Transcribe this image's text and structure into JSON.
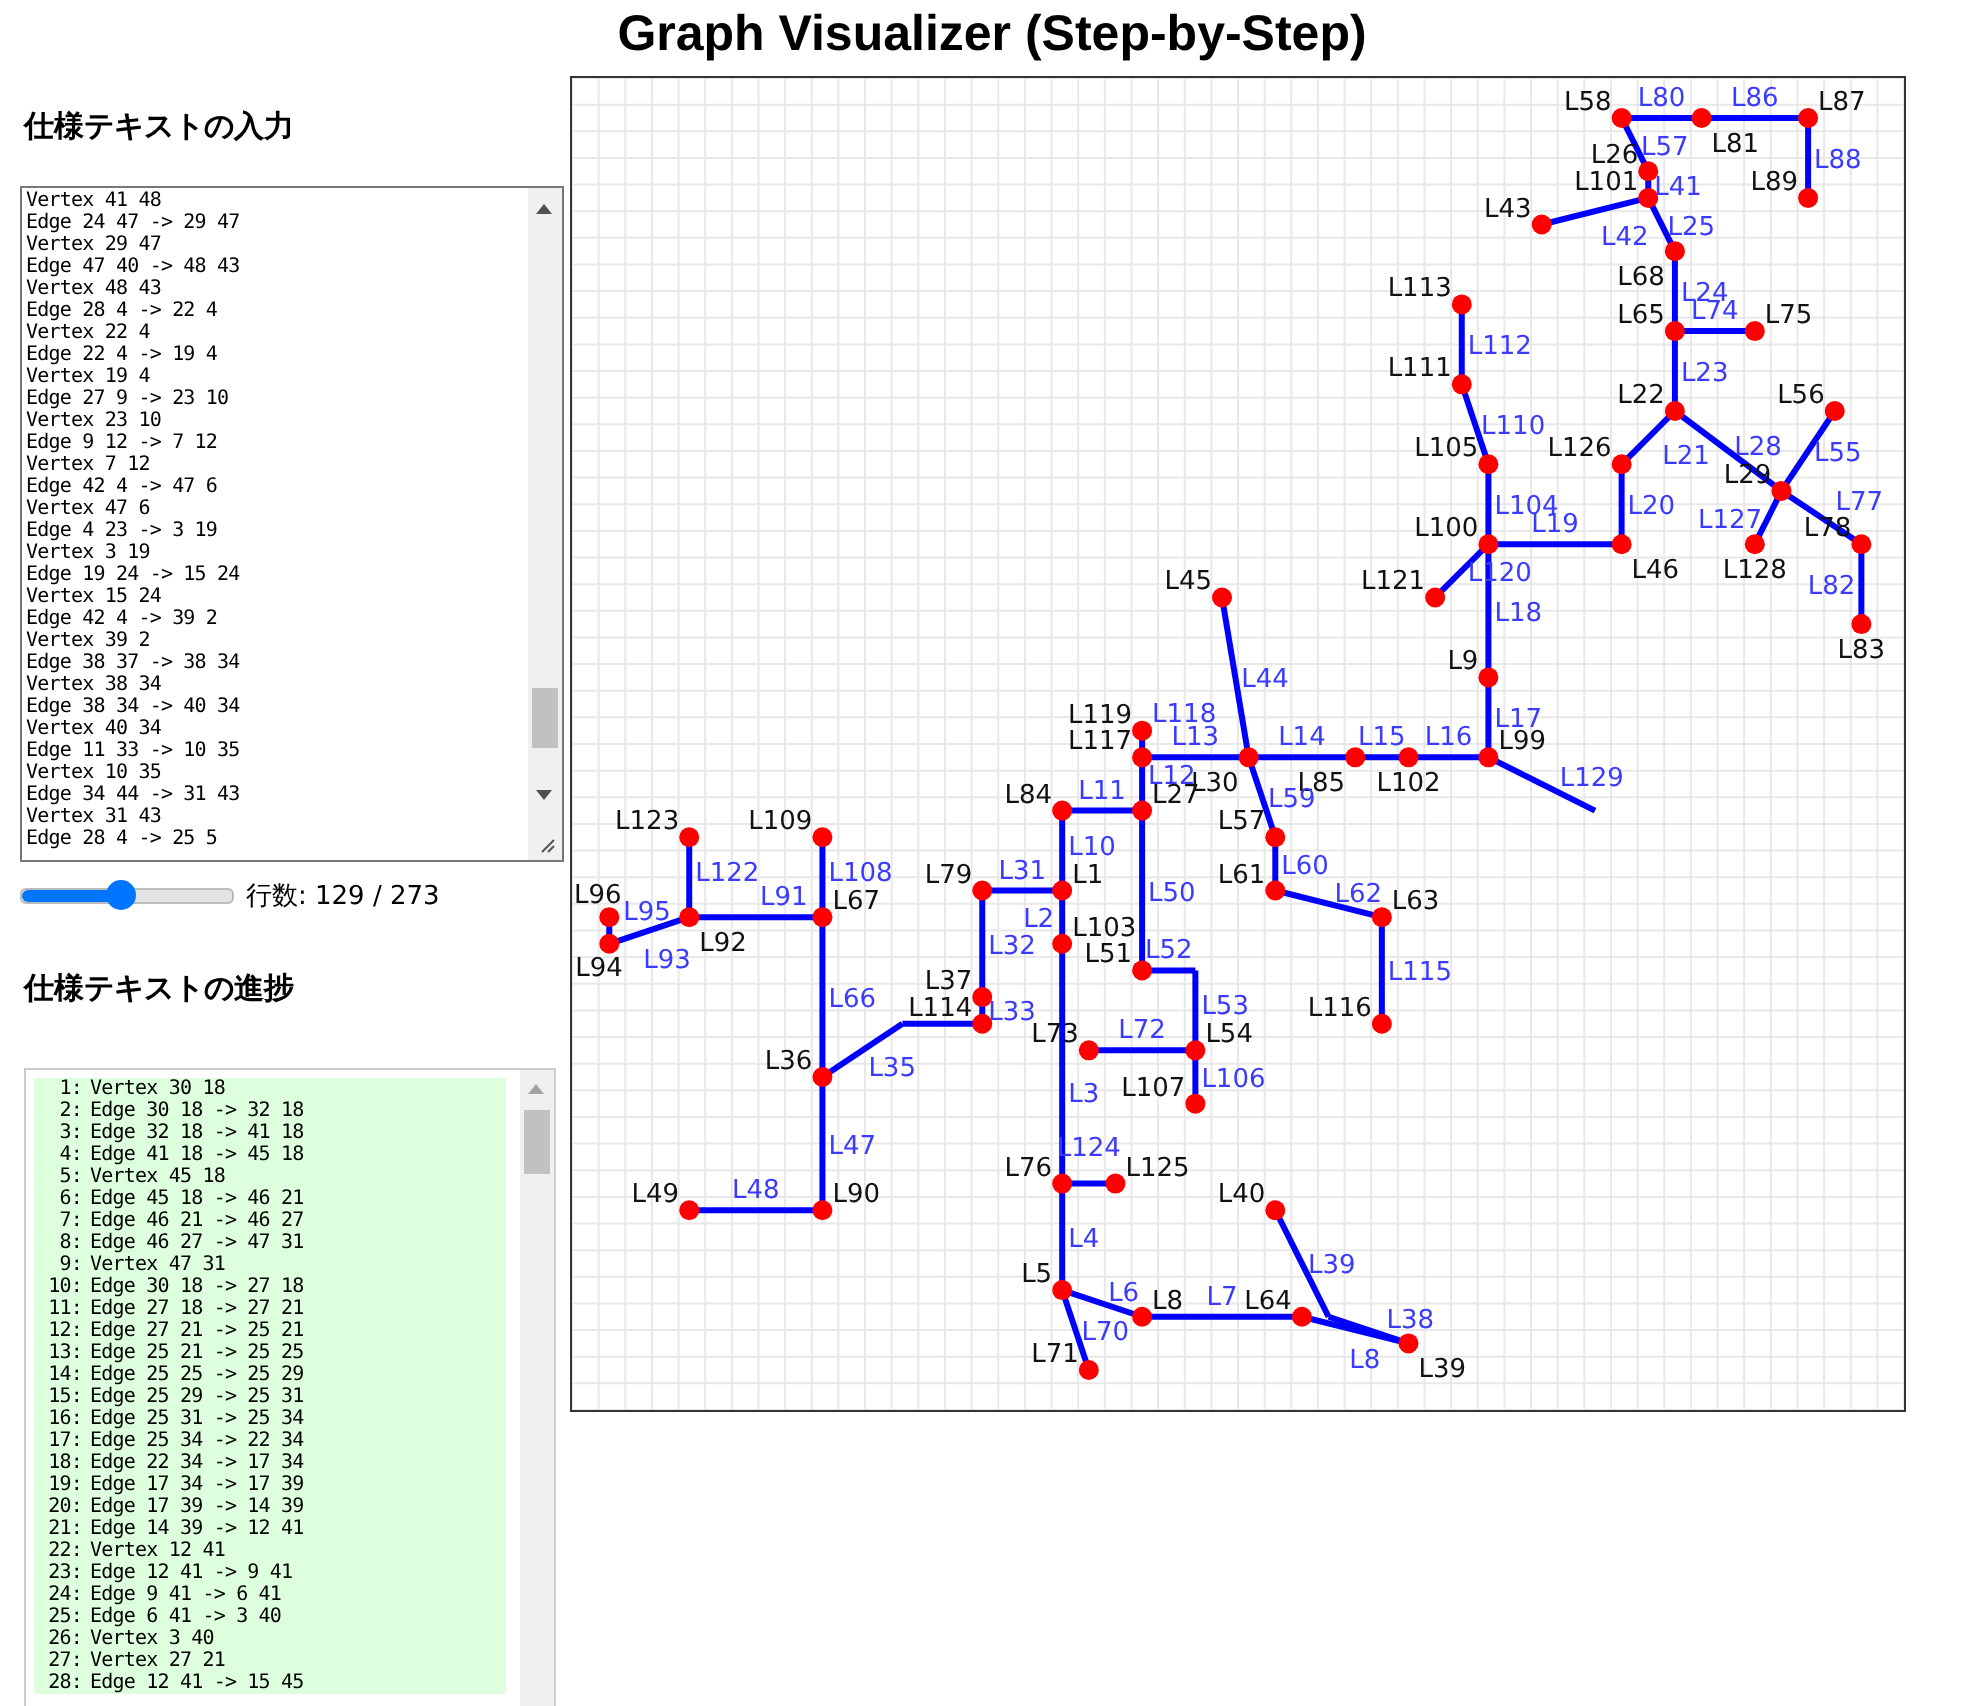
{
  "title": "Graph Visualizer (Step-by-Step)",
  "input_panel": {
    "heading": "仕様テキストの入力",
    "lines": [
      "Vertex 41 48",
      "Edge 24 47 -> 29 47",
      "Vertex 29 47",
      "Edge 47 40 -> 48 43",
      "Vertex 48 43",
      "Edge 28 4 -> 22 4",
      "Vertex 22 4",
      "Edge 22 4 -> 19 4",
      "Vertex 19 4",
      "Edge 27 9 -> 23 10",
      "Vertex 23 10",
      "Edge 9 12 -> 7 12",
      "Vertex 7 12",
      "Edge 42 4 -> 47 6",
      "Vertex 47 6",
      "Edge 4 23 -> 3 19",
      "Vertex 3 19",
      "Edge 19 24 -> 15 24",
      "Vertex 15 24",
      "Edge 42 4 -> 39 2",
      "Vertex 39 2",
      "Edge 38 37 -> 38 34",
      "Vertex 38 34",
      "Edge 38 34 -> 40 34",
      "Vertex 40 34",
      "Edge 11 33 -> 10 35",
      "Vertex 10 35",
      "Edge 34 44 -> 31 43",
      "Vertex 31 43",
      "Edge 28 4 -> 25 5"
    ],
    "slider": {
      "level": 0.47
    },
    "line_count": "行数: 129 / 273"
  },
  "progress_panel": {
    "heading": "仕様テキストの進捗",
    "lines": [
      {
        "num": "1:",
        "text": "Vertex 30 18",
        "done": true
      },
      {
        "num": "2:",
        "text": "Edge 30 18 -> 32 18",
        "done": true
      },
      {
        "num": "3:",
        "text": "Edge 32 18 -> 41 18",
        "done": true
      },
      {
        "num": "4:",
        "text": "Edge 41 18 -> 45 18",
        "done": true
      },
      {
        "num": "5:",
        "text": "Vertex 45 18",
        "done": true
      },
      {
        "num": "6:",
        "text": "Edge 45 18 -> 46 21",
        "done": true
      },
      {
        "num": "7:",
        "text": "Edge 46 21 -> 46 27",
        "done": true
      },
      {
        "num": "8:",
        "text": "Edge 46 27 -> 47 31",
        "done": true
      },
      {
        "num": "9:",
        "text": "Vertex 47 31",
        "done": true
      },
      {
        "num": "10:",
        "text": "Edge 30 18 -> 27 18",
        "done": true
      },
      {
        "num": "11:",
        "text": "Edge 27 18 -> 27 21",
        "done": true
      },
      {
        "num": "12:",
        "text": "Edge 27 21 -> 25 21",
        "done": true
      },
      {
        "num": "13:",
        "text": "Edge 25 21 -> 25 25",
        "done": true
      },
      {
        "num": "14:",
        "text": "Edge 25 25 -> 25 29",
        "done": true
      },
      {
        "num": "15:",
        "text": "Edge 25 29 -> 25 31",
        "done": true
      },
      {
        "num": "16:",
        "text": "Edge 25 31 -> 25 34",
        "done": true
      },
      {
        "num": "17:",
        "text": "Edge 25 34 -> 22 34",
        "done": true
      },
      {
        "num": "18:",
        "text": "Edge 22 34 -> 17 34",
        "done": true
      },
      {
        "num": "19:",
        "text": "Edge 17 34 -> 17 39",
        "done": true
      },
      {
        "num": "20:",
        "text": "Edge 17 39 -> 14 39",
        "done": true
      },
      {
        "num": "21:",
        "text": "Edge 14 39 -> 12 41",
        "done": true
      },
      {
        "num": "22:",
        "text": "Vertex 12 41",
        "done": true
      },
      {
        "num": "23:",
        "text": "Edge 12 41 -> 9 41",
        "done": true
      },
      {
        "num": "24:",
        "text": "Edge 9 41 -> 6 41",
        "done": true
      },
      {
        "num": "25:",
        "text": "Edge 6 41 -> 3 40",
        "done": true
      },
      {
        "num": "26:",
        "text": "Vertex 3 40",
        "done": true
      },
      {
        "num": "27:",
        "text": "Vertex 27 21",
        "done": true
      },
      {
        "num": "28:",
        "text": "Edge 12 41 -> 15 45",
        "done": true
      }
    ]
  },
  "graph": {
    "nodes": [
      {
        "label": "L58"
      },
      {
        "label": "L81"
      },
      {
        "label": "L87"
      },
      {
        "label": "L26"
      },
      {
        "label": "L101"
      },
      {
        "label": "L89"
      },
      {
        "label": "L43"
      },
      {
        "label": "L68"
      },
      {
        "label": "L113"
      },
      {
        "label": "L65"
      },
      {
        "label": "L75"
      },
      {
        "label": "L111"
      },
      {
        "label": "L22"
      },
      {
        "label": "L56"
      },
      {
        "label": "L105"
      },
      {
        "label": "L126"
      },
      {
        "label": "L29"
      },
      {
        "label": "L100"
      },
      {
        "label": "L46"
      },
      {
        "label": "L128"
      },
      {
        "label": "L78"
      },
      {
        "label": "L45"
      },
      {
        "label": "L121"
      },
      {
        "label": "L83"
      },
      {
        "label": "L9"
      },
      {
        "label": "L119"
      },
      {
        "label": "L117"
      },
      {
        "label": "L30"
      },
      {
        "label": "L85"
      },
      {
        "label": "L102"
      },
      {
        "label": "L99"
      },
      {
        "label": "L84"
      },
      {
        "label": "L27"
      },
      {
        "label": "L123"
      },
      {
        "label": "L109"
      },
      {
        "label": "L57"
      },
      {
        "label": "L79"
      },
      {
        "label": "L1"
      },
      {
        "label": "L61"
      },
      {
        "label": "L96"
      },
      {
        "label": "L92"
      },
      {
        "label": "L67"
      },
      {
        "label": "L63"
      },
      {
        "label": "L94"
      },
      {
        "label": "L103"
      },
      {
        "label": "L51"
      },
      {
        "label": "L37"
      },
      {
        "label": "L114"
      },
      {
        "label": "L116"
      },
      {
        "label": "L73"
      },
      {
        "label": "L54"
      },
      {
        "label": "L36"
      },
      {
        "label": "L107"
      },
      {
        "label": "L76"
      },
      {
        "label": "L125"
      },
      {
        "label": "L49"
      },
      {
        "label": "L90"
      },
      {
        "label": "L40"
      },
      {
        "label": "L5"
      },
      {
        "label": "L8"
      },
      {
        "label": "L64"
      },
      {
        "label": "L39"
      },
      {
        "label": "L71"
      }
    ],
    "edges": [
      {
        "label": "L80"
      },
      {
        "label": "L86"
      },
      {
        "label": "L57"
      },
      {
        "label": "L88"
      },
      {
        "label": "L41"
      },
      {
        "label": "L42"
      },
      {
        "label": "L25"
      },
      {
        "label": "L24"
      },
      {
        "label": "L74"
      },
      {
        "label": "L112"
      },
      {
        "label": "L23"
      },
      {
        "label": "L110"
      },
      {
        "label": "L21"
      },
      {
        "label": "L28"
      },
      {
        "label": "L55"
      },
      {
        "label": "L104"
      },
      {
        "label": "L20"
      },
      {
        "label": "L127"
      },
      {
        "label": "L77"
      },
      {
        "label": "L19"
      },
      {
        "label": "L120"
      },
      {
        "label": "L82"
      },
      {
        "label": "L18"
      },
      {
        "label": "L44"
      },
      {
        "label": "L17"
      },
      {
        "label": "L118"
      },
      {
        "label": "L13"
      },
      {
        "label": "L14"
      },
      {
        "label": "L15"
      },
      {
        "label": "L16"
      },
      {
        "label": "L12"
      },
      {
        "label": "L129"
      },
      {
        "label": "L59"
      },
      {
        "label": "L11"
      },
      {
        "label": "L10"
      },
      {
        "label": "L122"
      },
      {
        "label": "L108"
      },
      {
        "label": "L31"
      },
      {
        "label": "L50"
      },
      {
        "label": "L60"
      },
      {
        "label": "L91"
      },
      {
        "label": "L62"
      },
      {
        "label": "L2"
      },
      {
        "label": "L95"
      },
      {
        "label": "L93"
      },
      {
        "label": "L32"
      },
      {
        "label": "L52"
      },
      {
        "label": "L115"
      },
      {
        "label": "L66"
      },
      {
        "label": "L33"
      },
      {
        "label": "L53"
      },
      {
        "label": "L35"
      },
      {
        "label": "L72"
      },
      {
        "label": "L3"
      },
      {
        "label": "L106"
      },
      {
        "label": "L47"
      },
      {
        "label": "L124"
      },
      {
        "label": "L48"
      },
      {
        "label": "L4"
      },
      {
        "label": "L39"
      },
      {
        "label": "L6"
      },
      {
        "label": "L7"
      },
      {
        "label": "L70"
      },
      {
        "label": "L8"
      },
      {
        "label": "L38"
      }
    ]
  }
}
